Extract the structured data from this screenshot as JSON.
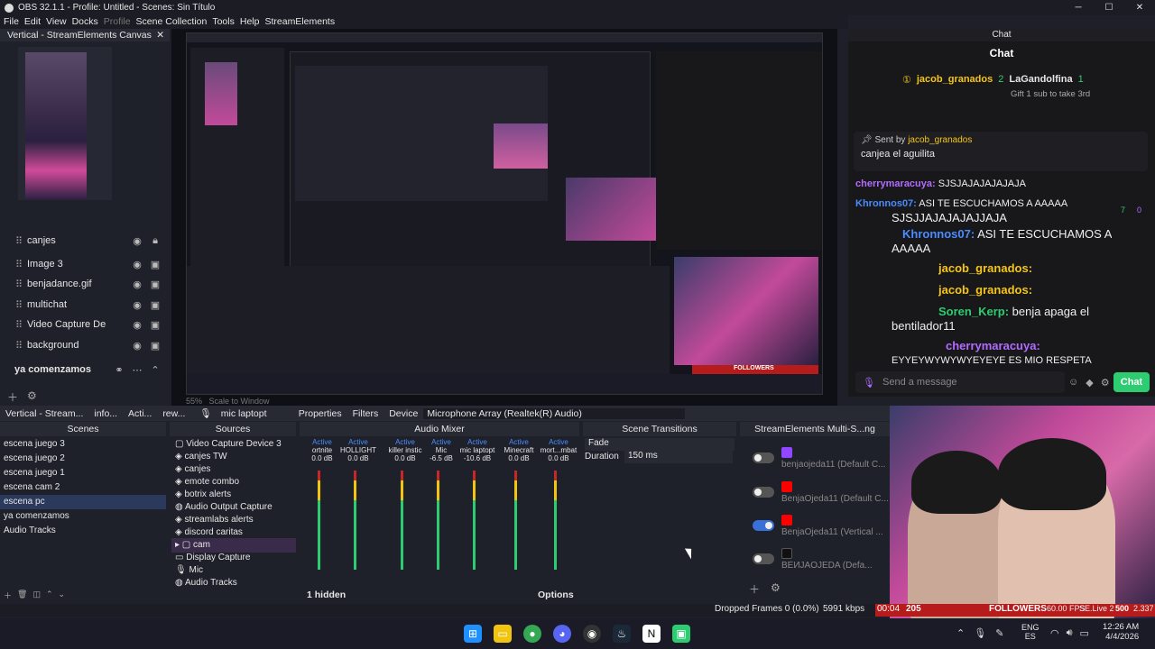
{
  "titlebar": {
    "title": "OBS 32.1.1 - Profile: Untitled - Scenes: Sin Título"
  },
  "menu": [
    "File",
    "Edit",
    "View",
    "Docks",
    "Profile",
    "Scene Collection",
    "Tools",
    "Help",
    "StreamElements"
  ],
  "canvas_dock": {
    "title": "Vertical - StreamElements Canvas",
    "sources": [
      {
        "name": "canjes"
      },
      {
        "name": "Image 3"
      },
      {
        "name": "benjadance.gif"
      },
      {
        "name": "multichat"
      },
      {
        "name": "Video Capture De"
      },
      {
        "name": "background"
      }
    ],
    "group": "ya comenzamos"
  },
  "chat": {
    "header": "Chat",
    "title": "Chat",
    "top_gifter": {
      "user": "jacob_granados",
      "count": "2",
      "other": "LaGandolfina",
      "other_count": "1",
      "note": "Gift 1 sub to take 3rd"
    },
    "pinned": {
      "sent_by": "Sent by",
      "user": "jacob_granados",
      "text": "canjea el aguilita"
    },
    "messages": [
      {
        "user": "cherrymaracuya:",
        "text": "SJSJAJAJAJAJAJA"
      },
      {
        "user": "Khronnos07:",
        "text": "ASI TE ESCUCHAMOS A AAAAA"
      },
      {
        "text": "SJSJJAJAJAJAJJAJA"
      },
      {
        "user": "Khronnos07:",
        "text": "ASI TE ESCUCHAMOS A"
      },
      {
        "text": "AAAAA"
      },
      {
        "user": "jacob_granados:",
        "text": ""
      },
      {
        "user": "jacob_granados:",
        "text": ""
      },
      {
        "user": "Soren_Kerp:",
        "text": "benja apaga el"
      },
      {
        "text": "bentilador11"
      },
      {
        "user": "cherrymaracuya:",
        "text": ""
      },
      {
        "text": "EYYEYWYWYWYEYEYE ES MIO RESPETA"
      }
    ],
    "badge_counts": [
      "7",
      "0"
    ],
    "input_placeholder": "Send a message",
    "send_label": "Chat"
  },
  "propbar": {
    "tab_a": "Vertical - Stream...",
    "tab_b": "info...",
    "tab_c": "Acti...",
    "tab_d": "rew...",
    "source": "mic laptopt",
    "properties": "Properties",
    "filters": "Filters",
    "device_label": "Device",
    "device_value": "Microphone Array (Realtek(R) Audio)"
  },
  "scenes": {
    "title": "Scenes",
    "items": [
      "escena juego 3",
      "escena juego 2",
      "escena juego 1",
      "escena cam 2",
      "escena pc",
      "ya comenzamos",
      "Audio Tracks"
    ],
    "selected": 4
  },
  "sources": {
    "title": "Sources",
    "items": [
      "Video Capture Device 3",
      "canjes TW",
      "canjes",
      "emote combo",
      "botrix alerts",
      "Audio Output Capture",
      "streamlabs alerts",
      "discord caritas",
      "cam",
      "Display Capture",
      "Mic",
      "Audio Tracks"
    ],
    "selected": 8
  },
  "mixer": {
    "title": "Audio Mixer",
    "channels": [
      {
        "name": "ortnite",
        "status": "Active",
        "db": "0.0 dB",
        "level": 0.5
      },
      {
        "name": "HOLLIGHT",
        "status": "Active",
        "db": "0.0 dB",
        "level": 0.3
      },
      {
        "name": "killer instic",
        "status": "Active",
        "db": "0.0 dB",
        "level": 0.6
      },
      {
        "name": "Mic",
        "status": "Active",
        "db": "-6.5 dB",
        "level": 0.2
      },
      {
        "name": "mic laptopt",
        "status": "Active",
        "db": "-10.6 dB",
        "level": 0.7
      },
      {
        "name": "Minecraft",
        "status": "Active",
        "db": "0.0 dB",
        "level": 0.4
      },
      {
        "name": "mort...mbat",
        "status": "Active",
        "db": "0.0 dB",
        "level": 0.5
      }
    ],
    "hidden": "1 hidden",
    "options": "Options"
  },
  "transitions": {
    "title": "Scene Transitions",
    "type": "Fade",
    "duration_label": "Duration",
    "duration": "150 ms"
  },
  "multistream": {
    "title": "StreamElements Multi-S...ng",
    "outputs": [
      {
        "platform": "Twitch",
        "name": "benjaojeda11 (Default C...",
        "on": false
      },
      {
        "platform": "YouTube",
        "name": "BenjaOjeda11 (Default C...",
        "on": false
      },
      {
        "platform": "YouTube",
        "name": "BenjaOjeda11 (Vertical ...",
        "on": true
      },
      {
        "platform": "TikTok",
        "name": "ВЕИJAOJEDA (Defa...",
        "on": false
      }
    ]
  },
  "status": {
    "dropped": "Dropped Frames 0 (0.0%)",
    "bitrate": "5991 kbps",
    "rec": "00:04",
    "followers_count": "205",
    "followers": "FOLLOWERS",
    "fps": "60.00 FPS",
    "se": "SE.Live 2",
    "se_val": "500",
    "se2": "2.337"
  },
  "tray": {
    "lang1": "ENG",
    "lang2": "ES",
    "time": "12:26 AM",
    "date": "4/4/2026"
  },
  "preview_overlay": {
    "followers": "FOLLOWERS",
    "count": "266"
  },
  "colors": {
    "accent": "#4a8cff",
    "twitch": "#9146ff",
    "youtube": "#ff0000",
    "chat_send": "#2ecc71"
  }
}
